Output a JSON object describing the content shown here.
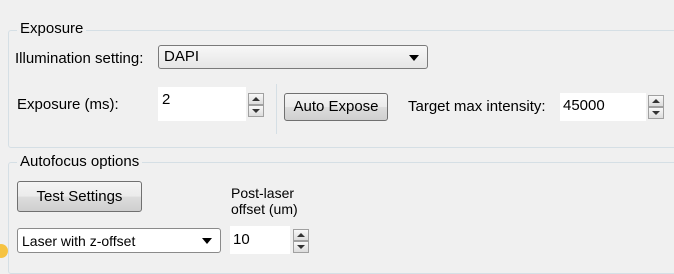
{
  "exposure": {
    "group_title": "Exposure",
    "illumination_label": "Illumination setting:",
    "illumination_value": "DAPI",
    "exposure_label": "Exposure (ms):",
    "exposure_value": "2",
    "auto_expose_label": "Auto Expose",
    "target_label": "Target max intensity:",
    "target_value": "45000"
  },
  "autofocus": {
    "group_title": "Autofocus options",
    "test_settings_label": "Test Settings",
    "post_laser_label_line1": "Post-laser",
    "post_laser_label_line2": "offset (um)",
    "mode_value": "Laser with z-offset",
    "offset_value": "10"
  }
}
